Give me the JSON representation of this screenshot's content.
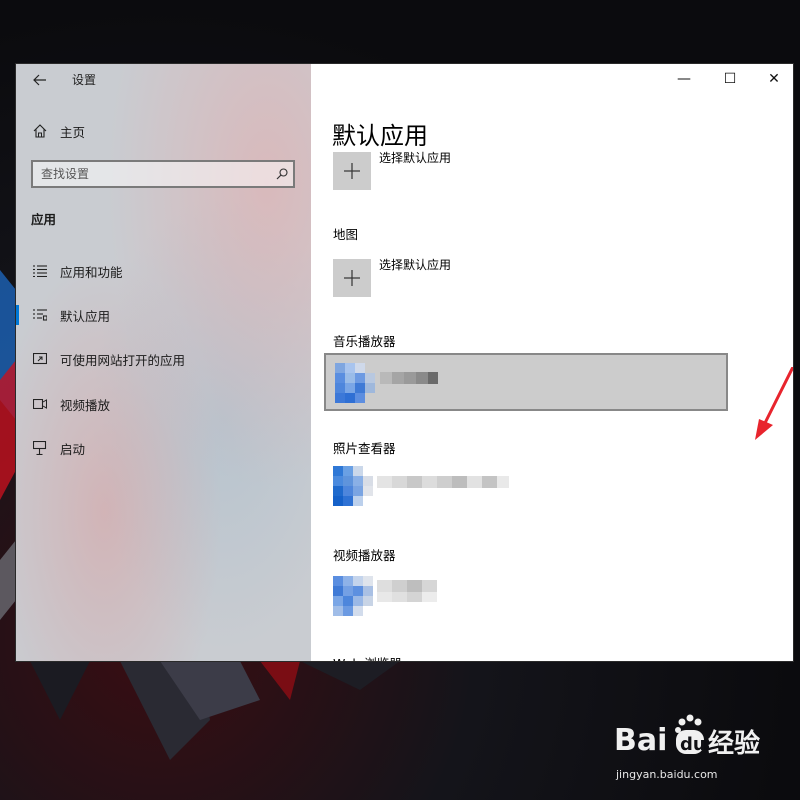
{
  "window": {
    "app_title": "设置",
    "controls": {
      "minimize": "—",
      "maximize": "☐",
      "close": "✕"
    }
  },
  "sidebar": {
    "home_label": "主页",
    "search_placeholder": "查找设置",
    "section_header": "应用",
    "items": [
      {
        "label": "应用和功能",
        "icon": "apps-features-icon",
        "selected": false
      },
      {
        "label": "默认应用",
        "icon": "default-apps-icon",
        "selected": true
      },
      {
        "label": "可使用网站打开的应用",
        "icon": "apps-for-websites-icon",
        "selected": false
      },
      {
        "label": "视频播放",
        "icon": "video-playback-icon",
        "selected": false
      },
      {
        "label": "启动",
        "icon": "startup-icon",
        "selected": false
      }
    ]
  },
  "main": {
    "page_title": "默认应用",
    "categories": [
      {
        "label": "",
        "app": "选择默认应用",
        "type": "choose"
      },
      {
        "label": "地图",
        "app": "选择默认应用",
        "type": "choose"
      },
      {
        "label": "音乐播放器",
        "app": "",
        "type": "blurred",
        "hovered": true
      },
      {
        "label": "照片查看器",
        "app": "",
        "type": "blurred"
      },
      {
        "label": "视频播放器",
        "app": "",
        "type": "blurred"
      },
      {
        "label": "Web 浏览器",
        "app": "",
        "type": "partial"
      }
    ]
  },
  "watermark": {
    "brand": "Baidu经验",
    "url": "jingyan.baidu.com"
  },
  "colors": {
    "accent": "#0078d7",
    "annotation_arrow": "#e8242d",
    "tile_gray": "#cccccc"
  }
}
